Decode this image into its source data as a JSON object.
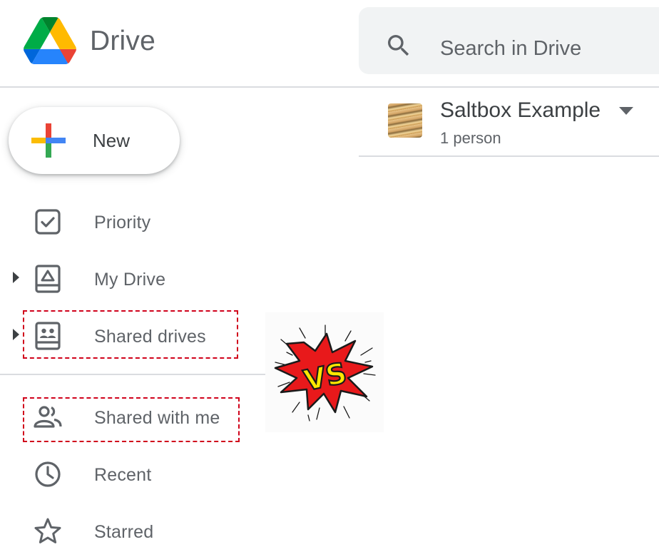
{
  "header": {
    "brand": "Drive",
    "search_placeholder": "Search in Drive",
    "logo_icon": "google-drive-logo-icon",
    "search_icon": "search-icon"
  },
  "sidebar": {
    "new_label": "New",
    "new_icon": "colored-plus-icon",
    "items": [
      {
        "label": "Priority",
        "icon": "priority-checkbox-icon",
        "expandable": false
      },
      {
        "label": "My Drive",
        "icon": "my-drive-icon",
        "expandable": true
      },
      {
        "label": "Shared drives",
        "icon": "shared-drives-icon",
        "expandable": true,
        "highlighted": true
      },
      {
        "label": "Shared with me",
        "icon": "people-icon",
        "expandable": false,
        "highlighted": true
      },
      {
        "label": "Recent",
        "icon": "clock-icon",
        "expandable": false
      },
      {
        "label": "Starred",
        "icon": "star-icon",
        "expandable": false
      }
    ]
  },
  "content": {
    "shared_drive_name": "Saltbox Example",
    "members": "1 person",
    "dropdown_icon": "caret-down-icon"
  },
  "overlay": {
    "badge_text": "VS",
    "colors": {
      "burst": "#e8191b",
      "text": "#ffe800",
      "outline": "#1a1a1a"
    }
  },
  "colors": {
    "highlight_dash": "#d0021b",
    "search_bg": "#f1f3f4",
    "icon_gray": "#5f6368"
  }
}
